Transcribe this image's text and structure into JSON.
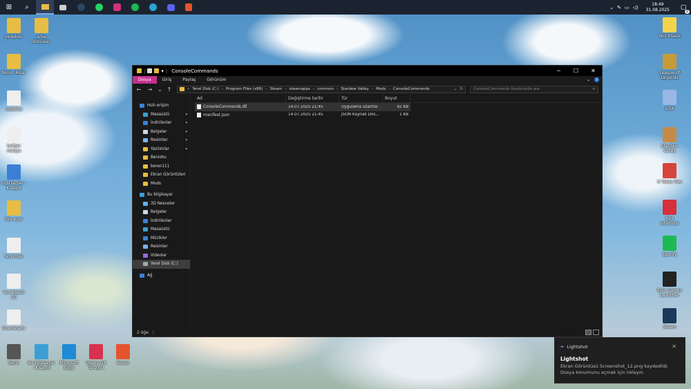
{
  "taskbar": {
    "apps": [
      "start-icon",
      "search-icon",
      "file-explorer-icon",
      "pinned-app-icon",
      "steam-icon",
      "whatsapp-icon",
      "instagram-icon",
      "spotify-icon",
      "edge-icon",
      "discord-icon",
      "brave-icon"
    ],
    "clock_time": "18:49",
    "clock_date": "31.08.2025",
    "notification_count": "2"
  },
  "desktop_left": [
    {
      "label": "yedekler",
      "color": "#e7bd43"
    },
    {
      "label": "ama dosyalar",
      "color": "#e7bd43"
    },
    {
      "label": "Resim Aolar",
      "color": "#e7bd43"
    },
    {
      "label": "mobilite",
      "color": "#eee"
    },
    {
      "label": "twitter medya",
      "color": "#eee"
    },
    {
      "label": "İndirilenler - Kısayol",
      "color": "#3b7fd4"
    },
    {
      "label": "Sky ayar",
      "color": "#e7bd43"
    },
    {
      "label": "Yazılımlar",
      "color": "#eee"
    },
    {
      "label": "Yeni klasör (3)",
      "color": "#eee"
    },
    {
      "label": "Downloads",
      "color": "#eee"
    }
  ],
  "desktop_bottom": [
    {
      "label": "Berin",
      "color": "#555"
    },
    {
      "label": "Bu bilgisayar - Kısayol",
      "color": "#3b9fd6"
    },
    {
      "label": "Microsoft Edge",
      "color": "#1f8ad6"
    },
    {
      "label": "Opera GX Tarayıcı",
      "color": "#d93250"
    },
    {
      "label": "Brave",
      "color": "#e5532d"
    }
  ],
  "desktop_right": [
    {
      "label": "Yeni Klasör",
      "color": "#f3d34a"
    },
    {
      "label": "League of Legends",
      "color": "#c79a3a"
    },
    {
      "label": "SiSK",
      "color": "#9ab7e5"
    },
    {
      "label": "Stardew Valley",
      "color": "#c58b46"
    },
    {
      "label": "It Takes Two",
      "color": "#d6453a"
    },
    {
      "label": "Riot İstemcisi",
      "color": "#d6303a"
    },
    {
      "label": "Spotify",
      "color": "#1db954"
    },
    {
      "label": "Epic Games Launcher",
      "color": "#222"
    },
    {
      "label": "Steam",
      "color": "#1b3a5a"
    }
  ],
  "explorer": {
    "title": "ConsoleCommands",
    "ribbon_tabs": [
      "Dosya",
      "Giriş",
      "Paylaş",
      "Görünüm"
    ],
    "breadcrumb": [
      "Yerel Disk (C:)",
      "Program Files (x86)",
      "Steam",
      "steamapps",
      "common",
      "Stardew Valley",
      "Mods",
      "ConsoleCommands"
    ],
    "search_placeholder": "ConsoleCommands klasöründe ara",
    "sidebar": [
      {
        "label": "Hızlı erişim",
        "head": true,
        "color": "#3b7fd4",
        "pin": false
      },
      {
        "label": "Masaüstü",
        "color": "#3b9fd6",
        "pin": true
      },
      {
        "label": "İndirilenler",
        "color": "#3b7fd4",
        "pin": true
      },
      {
        "label": "Belgeler",
        "color": "#cfd8e6",
        "pin": true
      },
      {
        "label": "Resimler",
        "color": "#7db2e6",
        "pin": true
      },
      {
        "label": "Yazılımlar",
        "color": "#e7bd43",
        "pin": true
      },
      {
        "label": "Benioku",
        "color": "#e7bd43",
        "pin": false
      },
      {
        "label": "beren111",
        "color": "#e7bd43",
        "pin": false
      },
      {
        "label": "Ekran Görüntüleri",
        "color": "#e7bd43",
        "pin": false
      },
      {
        "label": "Mods",
        "color": "#e7bd43",
        "pin": false
      },
      {
        "label": "",
        "spacer": true
      },
      {
        "label": "Bu bilgisayar",
        "head": true,
        "color": "#3b9fd6",
        "pin": false
      },
      {
        "label": "3D Nesneler",
        "color": "#5fb0e6",
        "pin": false
      },
      {
        "label": "Belgeler",
        "color": "#cfd8e6",
        "pin": false
      },
      {
        "label": "İndirilenler",
        "color": "#3b7fd4",
        "pin": false
      },
      {
        "label": "Masaüstü",
        "color": "#3b9fd6",
        "pin": false
      },
      {
        "label": "Müzikler",
        "color": "#3b7fd4",
        "pin": false
      },
      {
        "label": "Resimler",
        "color": "#7db2e6",
        "pin": false
      },
      {
        "label": "Videolar",
        "color": "#8f6fd4",
        "pin": false
      },
      {
        "label": "Yerel Disk (C:)",
        "color": "#9aa",
        "pin": false,
        "sel": true
      },
      {
        "label": "",
        "spacer": true
      },
      {
        "label": "Ağ",
        "head": true,
        "color": "#3b7fd4",
        "pin": false
      }
    ],
    "columns": [
      "Ad",
      "Değiştirme tarihi",
      "Tür",
      "Boyut"
    ],
    "files": [
      {
        "name": "ConsoleCommands.dll",
        "date": "14.07.2025 21:45",
        "type": "Uygulama uzantısı",
        "size": "92 KB"
      },
      {
        "name": "manifest.json",
        "date": "14.07.2025 21:45",
        "type": "JSON Kaynak Dos...",
        "size": "1 KB"
      }
    ],
    "status": "2 öğe"
  },
  "toast": {
    "app": "Lightshot",
    "title": "Lightshot",
    "message": "Ekran Görüntüsü Screenshot_12.png kaydedildi. Dosya konumunu açmak için tıklayın."
  }
}
